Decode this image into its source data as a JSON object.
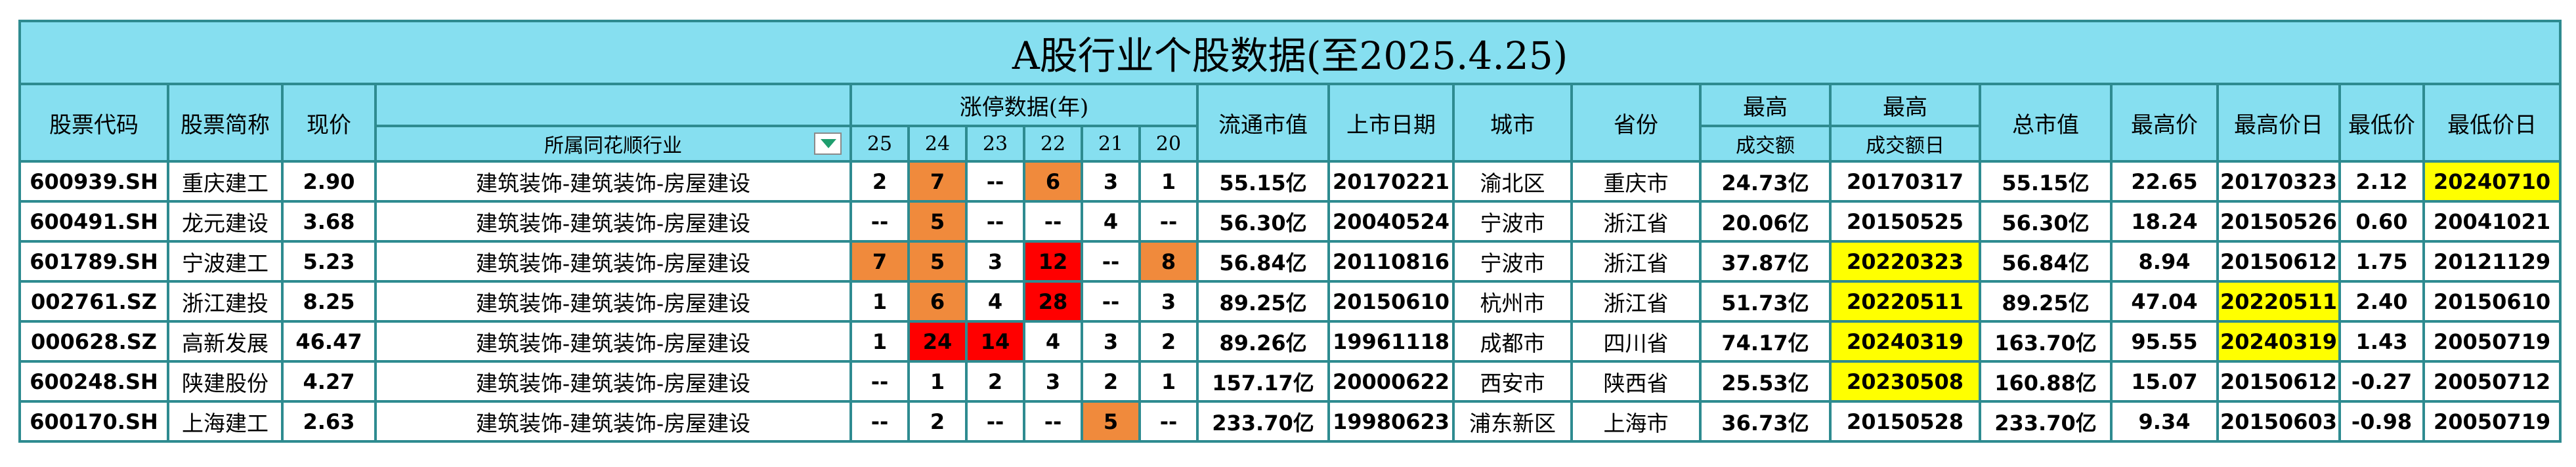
{
  "title": "A股行业个股数据(至2025.4.25)",
  "headers": {
    "code": "股票代码",
    "name": "股票简称",
    "price": "现价",
    "industry": "所属同花顺行业",
    "limit_group": "涨停数据(年)",
    "years": [
      "25",
      "24",
      "23",
      "22",
      "21",
      "20"
    ],
    "float_cap": "流通市值",
    "list_date": "上市日期",
    "city": "城市",
    "province": "省份",
    "max_vol_top": "最高",
    "max_vol_bottom": "成交额",
    "max_vol_date_top": "最高",
    "max_vol_date_bottom": "成交额日",
    "total_cap": "总市值",
    "high": "最高价",
    "high_date": "最高价日",
    "low": "最低价",
    "low_date": "最低价日"
  },
  "colors": {
    "header_bg": "#86dff0",
    "border": "#2e8b90",
    "orange": "#f08a3c",
    "red": "#ff0000",
    "yellow": "#ffff00",
    "dropdown_arrow": "#1f9e6e"
  },
  "icons": {
    "filter": "dropdown-arrow-icon"
  },
  "rows": [
    {
      "code": "600939.SH",
      "name": "重庆建工",
      "price": "2.90",
      "industry": "建筑装饰-建筑装饰-房屋建设",
      "limits": [
        "2",
        "7",
        "--",
        "6",
        "3",
        "1"
      ],
      "limit_hl": [
        "",
        "orange",
        "",
        "orange",
        "",
        ""
      ],
      "float_cap": "55.15亿",
      "list_date": "20170221",
      "city": "渝北区",
      "province": "重庆市",
      "max_vol": "24.73亿",
      "max_vol_date": "20170317",
      "max_vol_date_hl": "",
      "total_cap": "55.15亿",
      "high": "22.65",
      "high_date": "20170323",
      "high_date_hl": "",
      "low": "2.12",
      "low_date": "20240710",
      "low_date_hl": "yellow"
    },
    {
      "code": "600491.SH",
      "name": "龙元建设",
      "price": "3.68",
      "industry": "建筑装饰-建筑装饰-房屋建设",
      "limits": [
        "--",
        "5",
        "--",
        "--",
        "4",
        "--"
      ],
      "limit_hl": [
        "",
        "orange",
        "",
        "",
        "",
        ""
      ],
      "float_cap": "56.30亿",
      "list_date": "20040524",
      "city": "宁波市",
      "province": "浙江省",
      "max_vol": "20.06亿",
      "max_vol_date": "20150525",
      "max_vol_date_hl": "",
      "total_cap": "56.30亿",
      "high": "18.24",
      "high_date": "20150526",
      "high_date_hl": "",
      "low": "0.60",
      "low_date": "20041021",
      "low_date_hl": ""
    },
    {
      "code": "601789.SH",
      "name": "宁波建工",
      "price": "5.23",
      "industry": "建筑装饰-建筑装饰-房屋建设",
      "limits": [
        "7",
        "5",
        "3",
        "12",
        "--",
        "8"
      ],
      "limit_hl": [
        "orange",
        "orange",
        "",
        "red",
        "",
        "orange"
      ],
      "float_cap": "56.84亿",
      "list_date": "20110816",
      "city": "宁波市",
      "province": "浙江省",
      "max_vol": "37.87亿",
      "max_vol_date": "20220323",
      "max_vol_date_hl": "yellow",
      "total_cap": "56.84亿",
      "high": "8.94",
      "high_date": "20150612",
      "high_date_hl": "",
      "low": "1.75",
      "low_date": "20121129",
      "low_date_hl": ""
    },
    {
      "code": "002761.SZ",
      "name": "浙江建投",
      "price": "8.25",
      "industry": "建筑装饰-建筑装饰-房屋建设",
      "limits": [
        "1",
        "6",
        "4",
        "28",
        "--",
        "3"
      ],
      "limit_hl": [
        "",
        "orange",
        "",
        "red",
        "",
        ""
      ],
      "float_cap": "89.25亿",
      "list_date": "20150610",
      "city": "杭州市",
      "province": "浙江省",
      "max_vol": "51.73亿",
      "max_vol_date": "20220511",
      "max_vol_date_hl": "yellow",
      "total_cap": "89.25亿",
      "high": "47.04",
      "high_date": "20220511",
      "high_date_hl": "yellow",
      "low": "2.40",
      "low_date": "20150610",
      "low_date_hl": ""
    },
    {
      "code": "000628.SZ",
      "name": "高新发展",
      "price": "46.47",
      "industry": "建筑装饰-建筑装饰-房屋建设",
      "limits": [
        "1",
        "24",
        "14",
        "4",
        "3",
        "2"
      ],
      "limit_hl": [
        "",
        "red",
        "red",
        "",
        "",
        ""
      ],
      "float_cap": "89.26亿",
      "list_date": "19961118",
      "city": "成都市",
      "province": "四川省",
      "max_vol": "74.17亿",
      "max_vol_date": "20240319",
      "max_vol_date_hl": "yellow",
      "total_cap": "163.70亿",
      "high": "95.55",
      "high_date": "20240319",
      "high_date_hl": "yellow",
      "low": "1.43",
      "low_date": "20050719",
      "low_date_hl": ""
    },
    {
      "code": "600248.SH",
      "name": "陕建股份",
      "price": "4.27",
      "industry": "建筑装饰-建筑装饰-房屋建设",
      "limits": [
        "--",
        "1",
        "2",
        "3",
        "2",
        "1"
      ],
      "limit_hl": [
        "",
        "",
        "",
        "",
        "",
        ""
      ],
      "float_cap": "157.17亿",
      "list_date": "20000622",
      "city": "西安市",
      "province": "陕西省",
      "max_vol": "25.53亿",
      "max_vol_date": "20230508",
      "max_vol_date_hl": "yellow",
      "total_cap": "160.88亿",
      "high": "15.07",
      "high_date": "20150612",
      "high_date_hl": "",
      "low": "-0.27",
      "low_date": "20050712",
      "low_date_hl": ""
    },
    {
      "code": "600170.SH",
      "name": "上海建工",
      "price": "2.63",
      "industry": "建筑装饰-建筑装饰-房屋建设",
      "limits": [
        "--",
        "2",
        "--",
        "--",
        "5",
        "--"
      ],
      "limit_hl": [
        "",
        "",
        "",
        "",
        "orange",
        ""
      ],
      "float_cap": "233.70亿",
      "list_date": "19980623",
      "city": "浦东新区",
      "province": "上海市",
      "max_vol": "36.73亿",
      "max_vol_date": "20150528",
      "max_vol_date_hl": "",
      "total_cap": "233.70亿",
      "high": "9.34",
      "high_date": "20150603",
      "high_date_hl": "",
      "low": "-0.98",
      "low_date": "20050719",
      "low_date_hl": ""
    }
  ]
}
